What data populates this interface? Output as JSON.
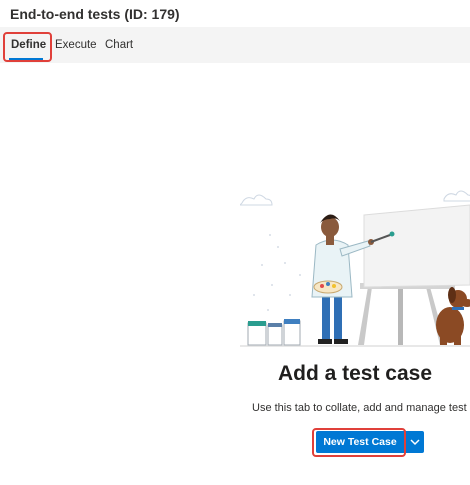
{
  "page": {
    "title": "End-to-end tests (ID: 179)"
  },
  "tabs": [
    {
      "label": "Define",
      "selected": true
    },
    {
      "label": "Execute",
      "selected": false
    },
    {
      "label": "Chart",
      "selected": false
    }
  ],
  "empty_state": {
    "heading": "Add a test case",
    "description": "Use this tab to collate, add and manage test ca",
    "primary_button": "New Test Case",
    "split_icon": "chevron-down-icon"
  },
  "colors": {
    "accent": "#0078d4",
    "highlight": "#e0403a",
    "tab_bar": "#f4f4f4"
  }
}
